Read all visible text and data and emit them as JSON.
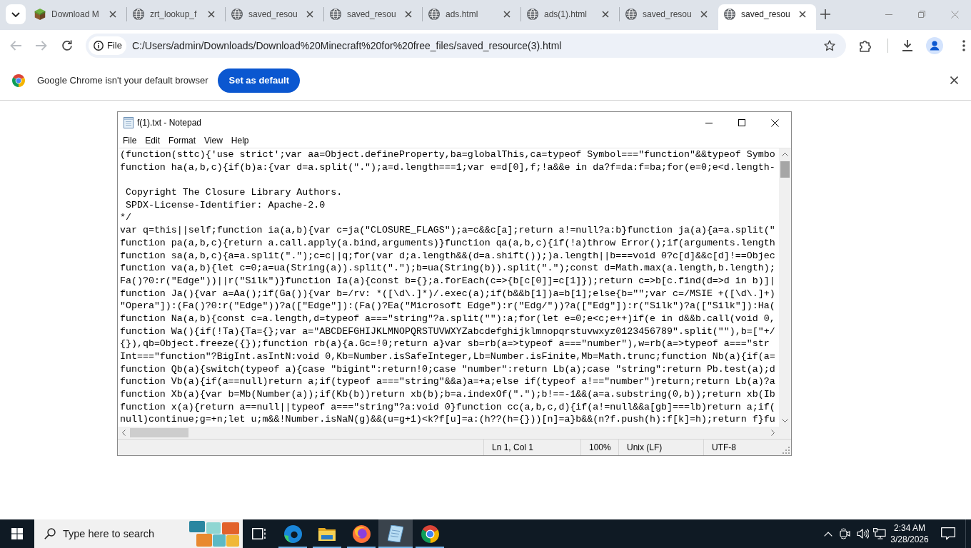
{
  "browser": {
    "tabs": [
      {
        "title": "Download M",
        "kind": "game",
        "selected": false
      },
      {
        "title": "zrt_lookup_f",
        "kind": "web",
        "selected": false
      },
      {
        "title": "saved_resou",
        "kind": "web",
        "selected": false
      },
      {
        "title": "saved_resou",
        "kind": "web",
        "selected": false
      },
      {
        "title": "ads.html",
        "kind": "web",
        "selected": false
      },
      {
        "title": "ads(1).html",
        "kind": "web",
        "selected": false
      },
      {
        "title": "saved_resou",
        "kind": "web",
        "selected": false
      },
      {
        "title": "saved_resou",
        "kind": "web",
        "selected": true
      }
    ],
    "toolbar": {
      "back_disabled": true,
      "forward_disabled": true,
      "security_chip": "File",
      "url": "C:/Users/admin/Downloads/Download%20Minecraft%20for%20free_files/saved_resource(3).html"
    },
    "infobar": {
      "message": "Google Chrome isn't your default browser",
      "button": "Set as default"
    }
  },
  "notepad": {
    "title": "f(1).txt - Notepad",
    "menu": [
      "File",
      "Edit",
      "Format",
      "View",
      "Help"
    ],
    "text_blocks": [
      [
        "(function(sttc){'use strict';var aa=Object.defineProperty,ba=globalThis,ca=typeof Symbol===\"function\"&&typeof Symbo",
        "function ha(a,b,c){if(b)a:{var d=a.split(\".\");a=d.length===1;var e=d[0],f;!a&&e in da?f=da:f=ba;for(e=0;e<d.length-"
      ],
      [
        " Copyright The Closure Library Authors.",
        " SPDX-License-Identifier: Apache-2.0",
        "*/",
        "var q=this||self;function ia(a,b){var c=ja(\"CLOSURE_FLAGS\");a=c&&c[a];return a!=null?a:b}function ja(a){a=a.split(\"",
        "function pa(a,b,c){return a.call.apply(a.bind,arguments)}function qa(a,b,c){if(!a)throw Error();if(arguments.length",
        "function sa(a,b,c){a=a.split(\".\");c=c||q;for(var d;a.length&&(d=a.shift());)a.length||b===void 0?c[d]&&c[d]!==Objec",
        "function va(a,b){let c=0;a=ua(String(a)).split(\".\");b=ua(String(b)).split(\".\");const d=Math.max(a.length,b.length);",
        "Fa()?0:r(\"Edge\"))||r(\"Silk\")}function Ia(a){const b={};a.forEach(c=>{b[c[0]]=c[1]});return c=>b[c.find(d=>d in b)]|",
        "function Ja(){var a=Aa();if(Ga()){var b=/rv: *([\\d\\.]*)/.exec(a);if(b&&b[1])a=b[1];else{b=\"\";var c=/MSIE +([\\d\\.]+)",
        "\"Opera\"]):(Fa()?0:r(\"Edge\"))?a([\"Edge\"]):(Fa()?Ea(\"Microsoft Edge\"):r(\"Edg/\"))?a([\"Edg\"]):r(\"Silk\")?a([\"Silk\"]):Ha(",
        "function Na(a,b){const c=a.length,d=typeof a===\"string\"?a.split(\"\"):a;for(let e=0;e<c;e++)if(e in d&&b.call(void 0,",
        "function Wa(){if(!Ta){Ta={};var a=\"ABCDEFGHIJKLMNOPQRSTUVWXYZabcdefghijklmnopqrstuvwxyz0123456789\".split(\"\"),b=[\"+/",
        "{}),qb=Object.freeze({});function rb(a){a.Gc=!0;return a}var sb=rb(a=>typeof a===\"number\"),w=rb(a=>typeof a===\"str",
        "Int===\"function\"?BigInt.asIntN:void 0,Kb=Number.isSafeInteger,Lb=Number.isFinite,Mb=Math.trunc;function Nb(a){if(a=",
        "function Qb(a){switch(typeof a){case \"bigint\":return!0;case \"number\":return Lb(a);case \"string\":return Pb.test(a);d",
        "function Vb(a){if(a==null)return a;if(typeof a===\"string\"&&a)a=+a;else if(typeof a!==\"number\")return;return Lb(a)?a",
        "function Xb(a){var b=Mb(Number(a));if(Kb(b))return xb(b);b=a.indexOf(\".\");b!==-1&&(a=a.substring(0,b));return xb(Ib",
        "function x(a){return a==null||typeof a===\"string\"?a:void 0}function cc(a,b,c,d){if(a!=null&&a[gb]===lb)return a;if(",
        "null)continue;g=+n;let u;m&&!Number.isNaN(g)&&(u=g+1)<k?f[u]=a:(h??(h={}))[n]=a}b&&(n?f.push(h):f[k]=h);return f}fu"
      ]
    ],
    "status_bar": [
      "Ln 1, Col 1",
      "100%",
      "Unix (LF)",
      "UTF-8"
    ]
  },
  "taskbar": {
    "search": {
      "placeholder": "Type here to search"
    },
    "apps": [
      {
        "kind": "edge",
        "running": true,
        "active": false
      },
      {
        "kind": "explorer",
        "running": true,
        "active": false
      },
      {
        "kind": "firefox",
        "running": true,
        "active": false
      },
      {
        "kind": "notepad",
        "running": true,
        "active": true
      },
      {
        "kind": "chrome",
        "running": true,
        "active": false
      }
    ],
    "time": "2:34 AM",
    "date": "3/28/2026"
  }
}
